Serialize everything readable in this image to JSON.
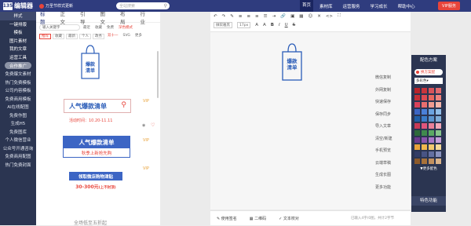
{
  "header": {
    "logo_mark": "135",
    "logo_text": "编辑器",
    "promo": "万圣节样式更新",
    "search_placeholder": "全站搜索",
    "nav": [
      "首页",
      "素材库",
      "运营服务",
      "学习成长",
      "帮助中心"
    ],
    "vip": "VIP服务"
  },
  "sidebar": {
    "items": [
      "样式",
      "一键排版",
      "模板",
      "图片素材",
      "我的文章",
      "运营工具",
      "合作推广",
      "免费爆文素材",
      "热门免费模板",
      "公司内容模板",
      "免费商用模板",
      "AI在线配图",
      "免费作图",
      "生成H5",
      "免费图库",
      "个人微信营业",
      "公众号开通咨询",
      "免费商用配图",
      "热门免费封面"
    ]
  },
  "panel": {
    "tabs": [
      "标题",
      "正文",
      "引导",
      "图文",
      "布局",
      "行业"
    ],
    "search_placeholder": "输入关键字",
    "tools": [
      "最近",
      "收藏",
      "免费",
      "深色模式"
    ],
    "chips": [
      "推荐",
      "收藏",
      "最新",
      "个人",
      "政务",
      "双十一",
      "SVG",
      "更多"
    ],
    "items": {
      "bag_text": [
        "爆款",
        "清单"
      ],
      "item1_title": "人气爆款清单",
      "item1_date": "活动时间：10.20-11.11",
      "vip": "VIP",
      "item2_title": "人气爆款清单",
      "item2_sub": "秋季上新抢先购",
      "item3_title": "领取微店购物津贴",
      "item3_sub": "30-300元",
      "item3_sub_small": "(上不封顶)",
      "item4": "全场低至五折起"
    }
  },
  "toolbar": {
    "row2": [
      "微软雅黑",
      "17px",
      "A",
      "A",
      "B",
      "I",
      "U",
      "S"
    ]
  },
  "canvas": {
    "text": [
      "爆款",
      "清单"
    ]
  },
  "actions": [
    "微信复制",
    "外网复制",
    "快速保存",
    "保存同步",
    "导入文章",
    "清空/新建",
    "手机预览",
    "云端草稿",
    "生成长图",
    "更多功能"
  ],
  "status": {
    "items": [
      "使用签名",
      "二维码",
      "文本校对"
    ],
    "stats": "已输入4字/0图，共计2字节"
  },
  "color_scheme": {
    "title": "配色方案",
    "picker_label": "换方案配",
    "select_label": "多彩色",
    "more": "▼更多配色",
    "features": "特色功能",
    "swatches": [
      "#b8232a",
      "#c9353c",
      "#d8545a",
      "#e26a6e",
      "#c62f37",
      "#dd4a52",
      "#e8675e",
      "#f0837d",
      "#d9425a",
      "#e86e6e",
      "#f09a8f",
      "#f5b5aa",
      "#3c65c4",
      "#4a80d8",
      "#6ba3e0",
      "#8fbde8",
      "#1f5fa8",
      "#3b7dc9",
      "#5c95cf",
      "#7faed9",
      "#c93a56",
      "#e0557c",
      "#ea8098",
      "#f2a7b7",
      "#2d6b3a",
      "#3f8a4d",
      "#5aa863",
      "#86c48a",
      "#6c3b8f",
      "#8a55ad",
      "#a878c7",
      "#c59fdb",
      "#e8a23a",
      "#f0b84d",
      "#f3c96f",
      "#f6d998",
      "#333d66",
      "#485484",
      "#6470a1",
      "#8a93bf",
      "#8c5a2a",
      "#a8723a",
      "#c2915e",
      "#d9b38a"
    ]
  }
}
